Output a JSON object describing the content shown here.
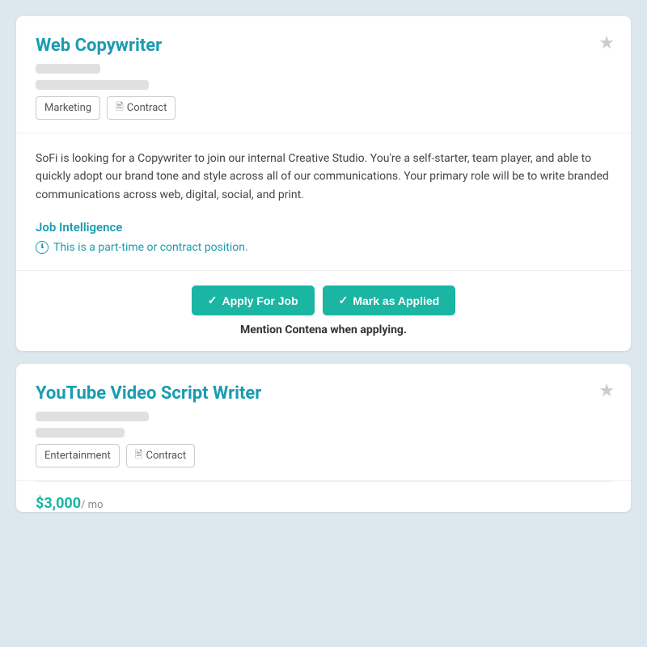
{
  "cards": [
    {
      "id": "web-copywriter",
      "title": "Web Copywriter",
      "tags": [
        {
          "label": "Marketing",
          "icon": null
        },
        {
          "label": "Contract",
          "icon": "doc"
        }
      ],
      "description": "SoFi is looking for a Copywriter to join our internal Creative Studio. You're a self-starter, team player, and able to quickly adopt our brand tone and style across all of our communications. Your primary role will be to write branded communications across web, digital, social, and print.",
      "intelligence_title": "Job Intelligence",
      "intelligence_text": "This is a part-time or contract position.",
      "apply_label": "Apply For Job",
      "mark_label": "Mark as Applied",
      "mention_text": "Mention Contena when applying.",
      "star_label": "★"
    },
    {
      "id": "youtube-script-writer",
      "title": "YouTube Video Script Writer",
      "tags": [
        {
          "label": "Entertainment",
          "icon": null
        },
        {
          "label": "Contract",
          "icon": "doc"
        }
      ],
      "salary": "$3,000",
      "salary_unit": "/ mo",
      "star_label": "★"
    }
  ],
  "icons": {
    "star": "★",
    "check": "✓",
    "doc": "🗋"
  }
}
